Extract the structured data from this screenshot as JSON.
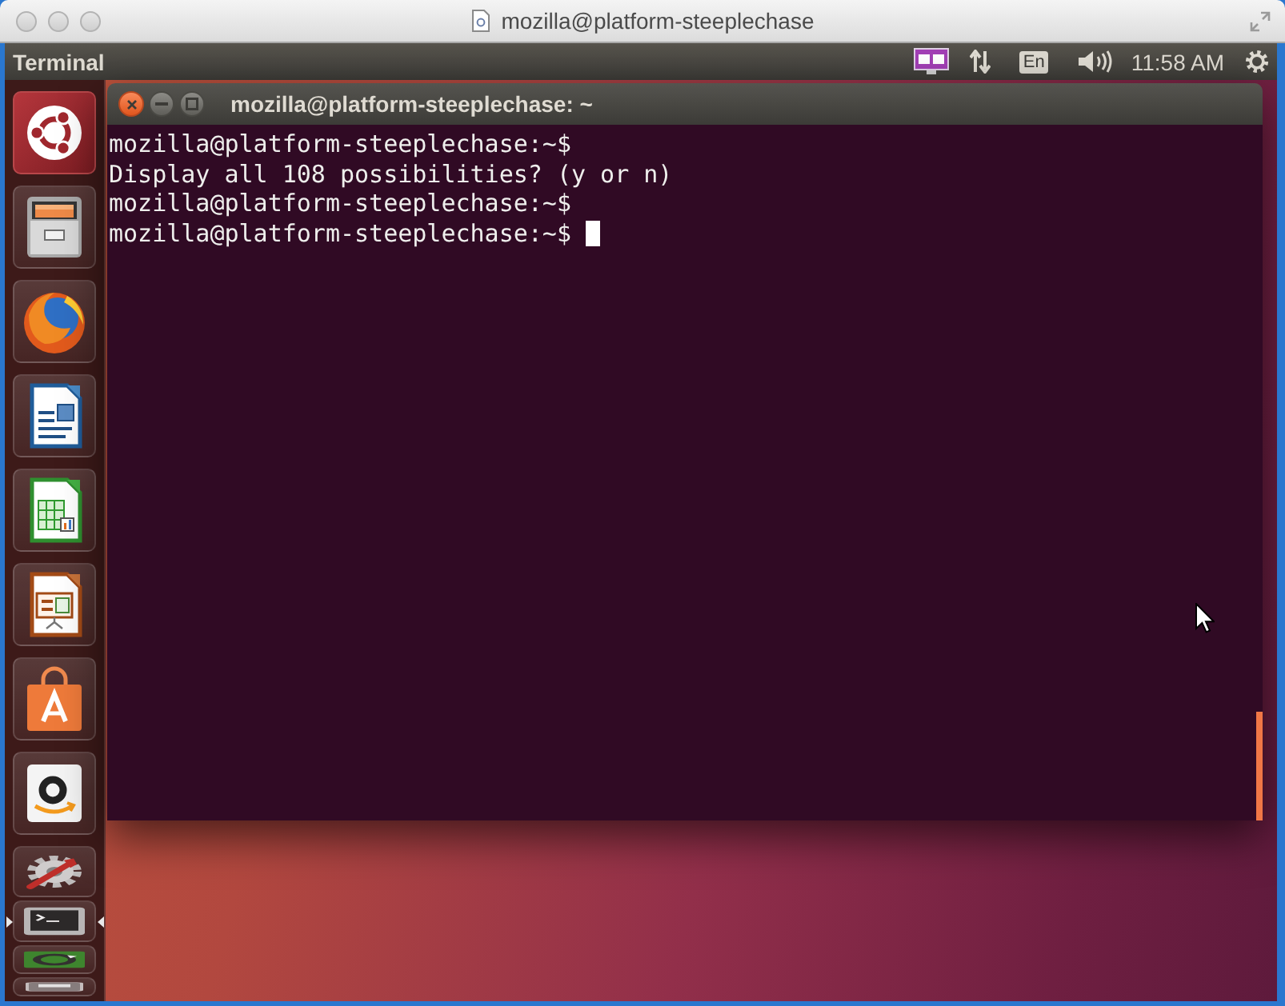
{
  "host_window": {
    "title": "mozilla@platform-steeplechase"
  },
  "top_panel": {
    "app_name": "Terminal",
    "keyboard_layout": "En",
    "clock": "11:58 AM"
  },
  "launcher": {
    "items": [
      {
        "kind": "dash",
        "folded": false,
        "running": false,
        "focused": false
      },
      {
        "kind": "files",
        "folded": false,
        "running": false,
        "focused": false
      },
      {
        "kind": "browser",
        "folded": false,
        "running": false,
        "focused": false
      },
      {
        "kind": "writer",
        "folded": false,
        "running": false,
        "focused": false
      },
      {
        "kind": "spreadsheet",
        "folded": false,
        "running": false,
        "focused": false
      },
      {
        "kind": "slides",
        "folded": false,
        "running": false,
        "focused": false
      },
      {
        "kind": "store",
        "folded": false,
        "running": false,
        "focused": false
      },
      {
        "kind": "smile",
        "folded": false,
        "running": false,
        "focused": false
      },
      {
        "kind": "settings",
        "folded": true,
        "running": false,
        "focused": false
      },
      {
        "kind": "terminal",
        "folded": true,
        "running": true,
        "focused": true
      },
      {
        "kind": "updates",
        "folded": true,
        "running": false,
        "focused": false
      },
      {
        "kind": "stack",
        "folded": true,
        "running": false,
        "focused": false
      }
    ]
  },
  "terminal": {
    "title": "mozilla@platform-steeplechase: ~",
    "lines": [
      "mozilla@platform-steeplechase:~$",
      "Display all 108 possibilities? (y or n)",
      "mozilla@platform-steeplechase:~$",
      "mozilla@platform-steeplechase:~$"
    ]
  }
}
